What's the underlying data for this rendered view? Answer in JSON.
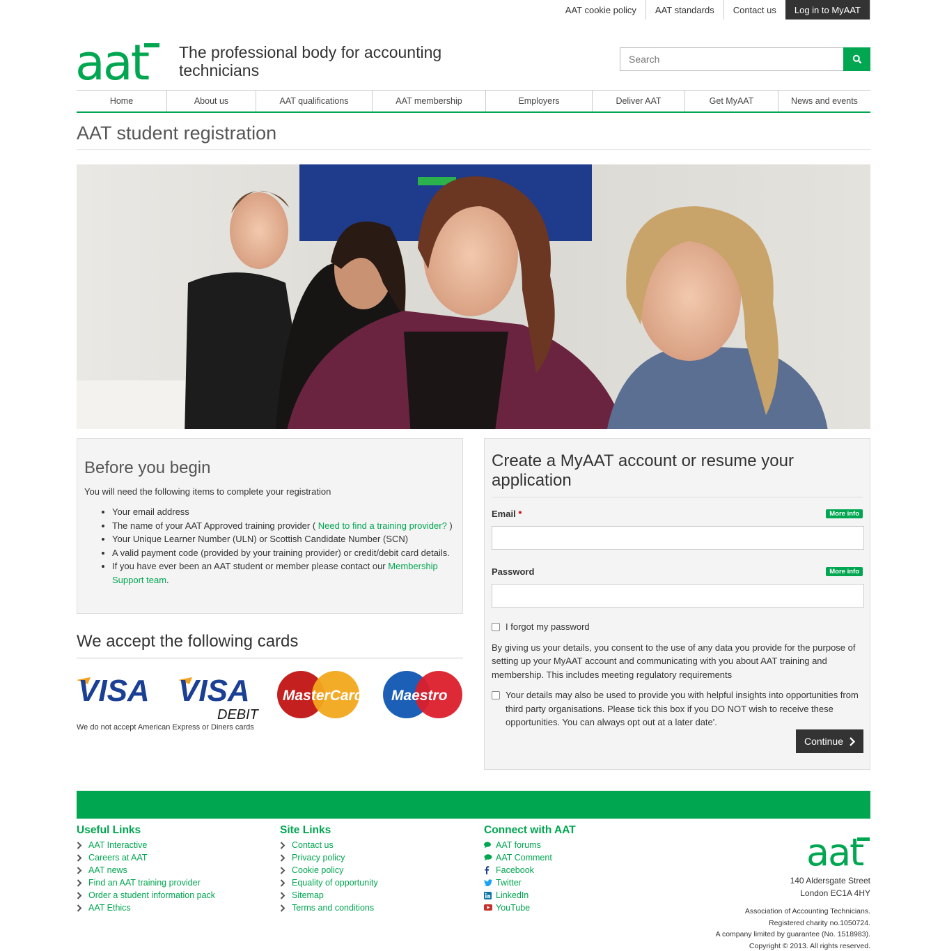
{
  "utility_nav": [
    "AAT cookie policy",
    "AAT standards",
    "Contact us",
    "Log in to MyAAT"
  ],
  "brand": {
    "logo_text": "aat",
    "tagline": "The professional body for accounting technicians",
    "accent": "#00a650"
  },
  "search": {
    "placeholder": "Search",
    "icon": "search-icon"
  },
  "main_nav": [
    "Home",
    "About us",
    "AAT qualifications",
    "AAT membership",
    "Employers",
    "Deliver AAT",
    "Get MyAAT",
    "News and events"
  ],
  "page_title": "AAT student registration",
  "before": {
    "heading": "Before you begin",
    "intro": "You will need the following items to complete your registration",
    "item1": "Your email address",
    "item2_pre": "The name of your AAT Approved training provider ( ",
    "item2_link": "Need to find a training provider?",
    "item2_post": " )",
    "item3": "Your Unique Learner Number (ULN) or Scottish Candidate Number (SCN)",
    "item4": "A valid payment code (provided by your training provider) or credit/debit card details.",
    "item5_pre": "If you have ever been an AAT student or member please contact our ",
    "item5_link": "Membership Support team",
    "item5_post": "."
  },
  "cards": {
    "heading": "We accept the following cards",
    "visa": "VISA",
    "visa_debit": "VISA",
    "debit": "DEBIT",
    "mastercard": "MasterCard",
    "maestro": "Maestro",
    "note": "We do not accept American Express or Diners cards"
  },
  "form": {
    "heading": "Create a MyAAT account or resume your application",
    "email_label": "Email",
    "required_mark": "*",
    "more_info": "More info",
    "password_label": "Password",
    "forgot": "I forgot my password",
    "consent": "By giving us your details, you consent to the use of any data you provide for the purpose of setting up your MyAAT account and communicating with you about AAT training and membership. This includes meeting regulatory requirements",
    "optout": "Your details may also be used to provide you with helpful insights into opportunities from third party organisations. Please tick this box if you DO NOT wish to receive these opportunities. You can always opt out at a later date'.",
    "continue": "Continue"
  },
  "footer": {
    "useful_title": "Useful Links",
    "useful": [
      "AAT Interactive",
      "Careers at AAT",
      "AAT news",
      "Find an AAT training provider",
      "Order a student information pack",
      "AAT Ethics"
    ],
    "site_title": "Site Links",
    "site": [
      "Contact us",
      "Privacy policy",
      "Cookie policy",
      "Equality of opportunity",
      "Sitemap",
      "Terms and conditions"
    ],
    "connect_title": "Connect with AAT",
    "connect": [
      "AAT forums",
      "AAT Comment",
      "Facebook",
      "Twitter",
      "LinkedIn",
      "YouTube"
    ],
    "address1": "140 Aldersgate Street",
    "address2": "London EC1A 4HY",
    "legal1": "Association of Accounting Technicians.",
    "legal2": "Registered charity no.1050724.",
    "legal3": "A company limited by guarantee (No. 1518983).",
    "legal4": "Copyright © 2013. All rights reserved."
  }
}
